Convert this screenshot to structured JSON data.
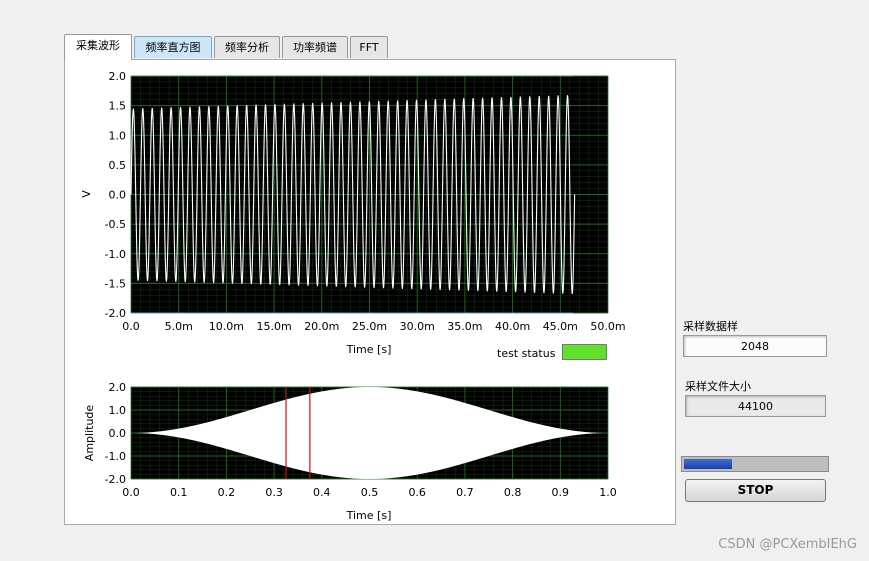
{
  "tabs": [
    {
      "label": "采集波形",
      "active": true
    },
    {
      "label": "频率直方图",
      "active": false,
      "highlight": true
    },
    {
      "label": "频率分析",
      "active": false
    },
    {
      "label": "功率频谱",
      "active": false
    },
    {
      "label": "FFT",
      "active": false
    }
  ],
  "graph1": {
    "ylabel": "V",
    "xlabel": "Time [s]",
    "yticks": [
      "2.0",
      "1.5",
      "1.0",
      "0.5",
      "0.0",
      "-0.5",
      "-1.0",
      "-1.5",
      "-2.0"
    ],
    "xticks": [
      "0.0",
      "5.0m",
      "10.0m",
      "15.0m",
      "20.0m",
      "25.0m",
      "30.0m",
      "35.0m",
      "40.0m",
      "45.0m",
      "50.0m"
    ],
    "colors": {
      "plot_bg": "#000000",
      "grid": "#1f7a1f",
      "trace": "#ffffff"
    }
  },
  "test_status_label": "test status",
  "test_status_color": "#5fe02a",
  "graph2": {
    "ylabel": "Amplitude",
    "xlabel": "Time [s]",
    "yticks": [
      "2.0",
      "1.0",
      "0.0",
      "-1.0",
      "-2.0"
    ],
    "xticks": [
      "0.0",
      "0.1",
      "0.2",
      "0.3",
      "0.4",
      "0.5",
      "0.6",
      "0.7",
      "0.8",
      "0.9",
      "1.0"
    ],
    "cursor_color": "#d01010"
  },
  "sample_count": {
    "label": "采样数据样",
    "value": "2048"
  },
  "file_size": {
    "label": "采样文件大小",
    "value": "44100"
  },
  "progress": {
    "fraction": 0.33
  },
  "stop_label": "STOP",
  "watermark": "CSDN @PCXembIEhG",
  "chart_data": [
    {
      "type": "line",
      "xlabel": "Time [s]",
      "ylabel": "V",
      "xlim": [
        0,
        0.05
      ],
      "ylim": [
        -2.0,
        2.0
      ],
      "grid": true,
      "x_end": 0.0465,
      "cycles": 47,
      "amplitude_start": 1.45,
      "amplitude_end": 1.68
    },
    {
      "type": "area",
      "xlabel": "Time [s]",
      "ylabel": "Amplitude",
      "xlim": [
        0,
        1.0
      ],
      "ylim": [
        -2.0,
        2.0
      ],
      "grid": true,
      "envelope_peak": 2.0,
      "envelope_center": 0.5,
      "cursors_x": [
        0.325,
        0.375
      ]
    }
  ]
}
